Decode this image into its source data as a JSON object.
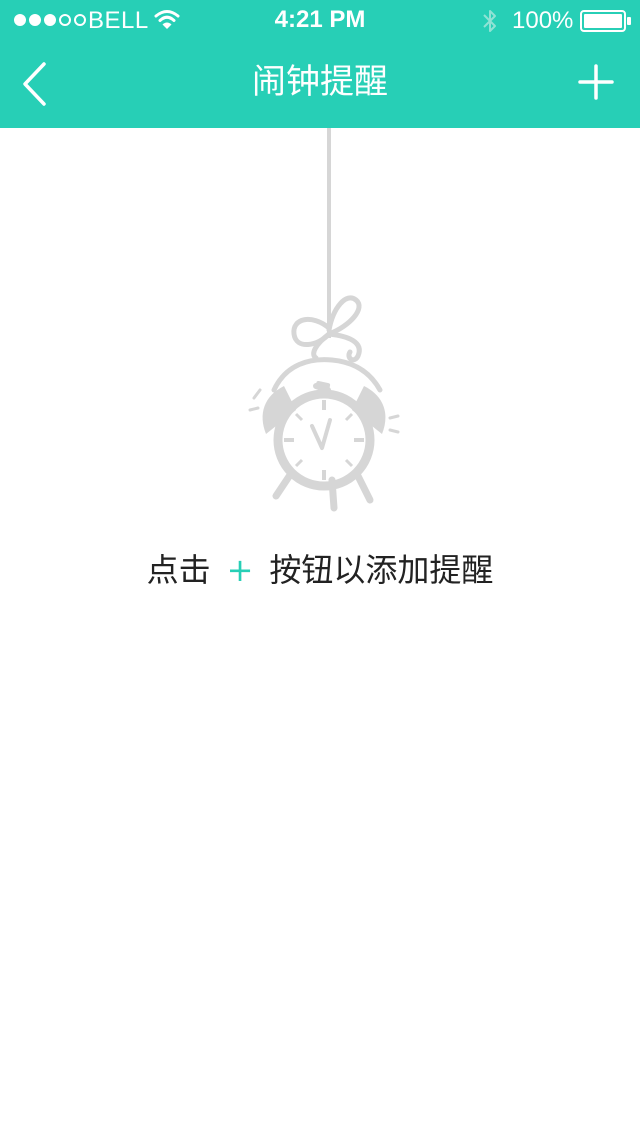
{
  "colors": {
    "accent": "#27cfb6",
    "background": "#ffffff",
    "illustration": "#d6d6d6",
    "text": "#222222"
  },
  "status_bar": {
    "signal_filled": 3,
    "signal_total": 5,
    "carrier": "BELL",
    "time": "4:21 PM",
    "battery": "100%",
    "icons": [
      "wifi-icon",
      "bluetooth-icon",
      "battery-icon"
    ]
  },
  "nav": {
    "back_icon": "chevron-left-icon",
    "title": "闹钟提醒",
    "add_icon": "plus-icon"
  },
  "empty_state": {
    "illustration": "hanging-alarm-clock-icon",
    "hint_before": "点击",
    "hint_plus": "+",
    "hint_after": "按钮以添加提醒"
  }
}
